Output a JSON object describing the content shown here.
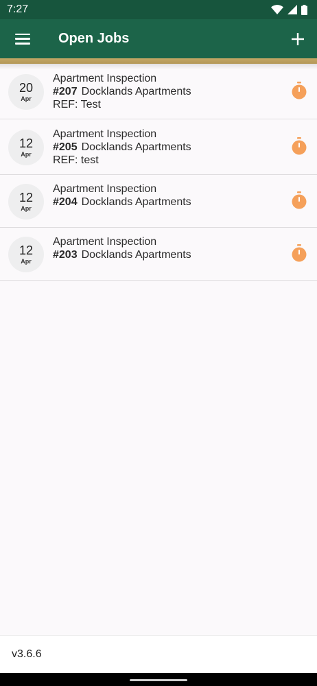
{
  "status_bar": {
    "time": "7:27",
    "icons": [
      "wifi-icon",
      "signal-icon",
      "battery-icon"
    ]
  },
  "app_bar": {
    "title": "Open Jobs",
    "menu_icon": "hamburger-menu-icon",
    "add_icon": "plus-icon"
  },
  "colors": {
    "status_bar": "#17553d",
    "app_bar": "#1c6449",
    "accent_gold": "#c3a765",
    "timer_orange": "#f5a05a"
  },
  "jobs": [
    {
      "day": "20",
      "month": "Apr",
      "title": "Apartment Inspection",
      "number": "#207",
      "location": "Docklands Apartments",
      "ref": "REF: Test"
    },
    {
      "day": "12",
      "month": "Apr",
      "title": "Apartment Inspection",
      "number": "#205",
      "location": "Docklands Apartments",
      "ref": "REF: test"
    },
    {
      "day": "12",
      "month": "Apr",
      "title": "Apartment Inspection",
      "number": "#204",
      "location": "Docklands Apartments",
      "ref": ""
    },
    {
      "day": "12",
      "month": "Apr",
      "title": "Apartment Inspection",
      "number": "#203",
      "location": "Docklands Apartments",
      "ref": ""
    }
  ],
  "footer": {
    "version": "v3.6.6"
  }
}
